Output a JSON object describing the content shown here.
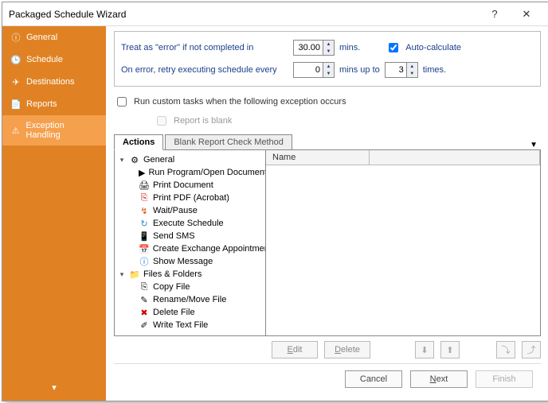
{
  "title": "Packaged Schedule Wizard",
  "sidebar": {
    "items": [
      {
        "label": "General"
      },
      {
        "label": "Schedule"
      },
      {
        "label": "Destinations"
      },
      {
        "label": "Reports"
      },
      {
        "label": "Exception Handling"
      }
    ]
  },
  "opts": {
    "treat_label": "Treat as \"error\" if not completed in",
    "treat_value": "30.00",
    "mins_label": "mins.",
    "auto_calc_label": "Auto-calculate",
    "auto_calc_checked": true,
    "retry_label": "On error, retry  executing schedule every",
    "retry_value": "0",
    "mins_upto_label": "mins up to",
    "times_value": "3",
    "times_label": "times."
  },
  "run_custom": {
    "label": "Run custom tasks when the following exception occurs",
    "checked": false
  },
  "report_blank_label": "Report is blank",
  "tabs": {
    "active": "Actions",
    "inactive": "Blank Report Check Method"
  },
  "tree": [
    {
      "type": "group",
      "label": "General"
    },
    {
      "type": "item",
      "label": "Run Program/Open Document"
    },
    {
      "type": "item",
      "label": "Print Document"
    },
    {
      "type": "item",
      "label": "Print PDF (Acrobat)"
    },
    {
      "type": "item",
      "label": "Wait/Pause"
    },
    {
      "type": "item",
      "label": "Execute Schedule"
    },
    {
      "type": "item",
      "label": "Send SMS"
    },
    {
      "type": "item",
      "label": "Create Exchange Appointment"
    },
    {
      "type": "item",
      "label": "Show Message"
    },
    {
      "type": "group",
      "label": "Files & Folders"
    },
    {
      "type": "item",
      "label": "Copy File"
    },
    {
      "type": "item",
      "label": "Rename/Move File"
    },
    {
      "type": "item",
      "label": "Delete File"
    },
    {
      "type": "item",
      "label": "Write Text File"
    }
  ],
  "list": {
    "name_header": "Name"
  },
  "toolbar": {
    "edit": "Edit",
    "delete": "Delete"
  },
  "footer": {
    "cancel": "Cancel",
    "next": "Next",
    "finish": "Finish"
  }
}
